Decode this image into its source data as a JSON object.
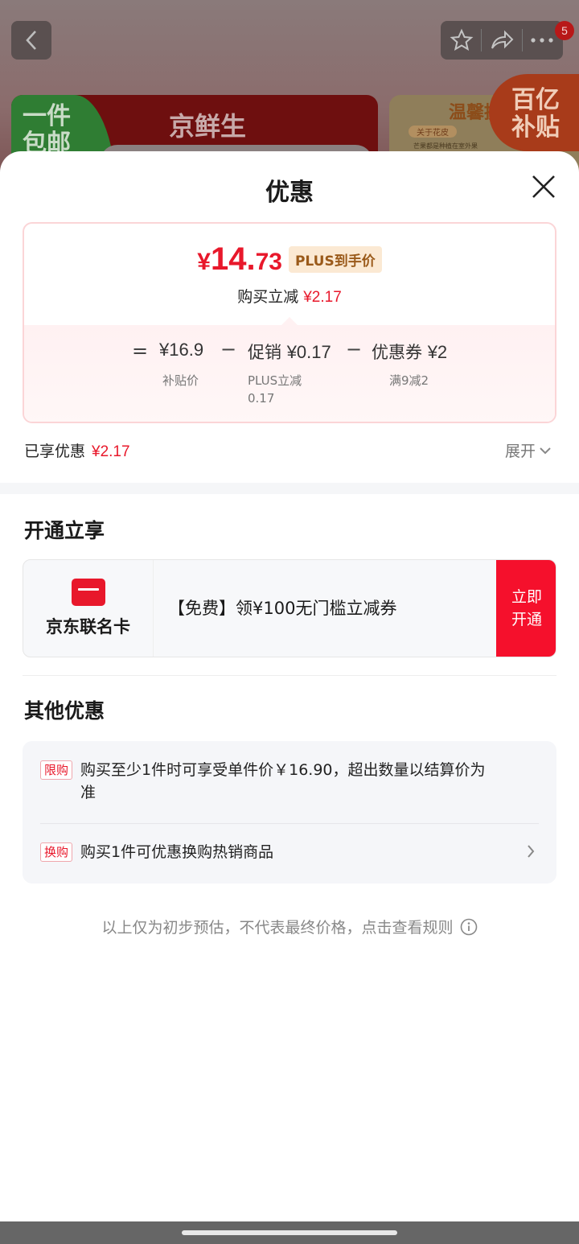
{
  "background": {
    "cart_badge": "5",
    "banner_left_tag": "一件包邮",
    "banner_left_title": "京鲜生",
    "banner_right_title": "温馨提",
    "banner_right_sub": "关于花皮",
    "banner_right_note": "芒果都是种植在室外果",
    "subsidy_label": "百亿补贴"
  },
  "sheet": {
    "title": "优惠"
  },
  "price_card": {
    "currency": "¥",
    "price_int": "14.",
    "price_dec": "73",
    "plus_tag": "PLUS到手价",
    "save_label": "购买立减",
    "save_amount": "¥2.17",
    "equals": "=",
    "minus": "−",
    "base_price": "¥16.9",
    "base_label": "补贴价",
    "promo_label": "促销",
    "promo_amount": "¥0.17",
    "promo_sub_line1": "PLUS立减",
    "promo_sub_line2": "0.17",
    "coupon_label": "优惠券",
    "coupon_amount": "¥2",
    "coupon_sub": "满9减2"
  },
  "enjoyed": {
    "label": "已享优惠",
    "amount": "¥2.17",
    "expand_label": "展开"
  },
  "open_section": {
    "title": "开通立享",
    "card_name": "京东联名卡",
    "offer_text": "【免费】领¥100无门槛立减券",
    "button_line1": "立即",
    "button_line2": "开通"
  },
  "other_section": {
    "title": "其他优惠",
    "items": [
      {
        "tag": "限购",
        "text": "购买至少1件时可享受单件价￥16.90，超出数量以结算价为准"
      },
      {
        "tag": "换购",
        "text": "购买1件可优惠换购热销商品"
      }
    ]
  },
  "footnote": "以上仅为初步预估，不代表最终价格，点击查看规则",
  "colors": {
    "accent_red": "#e8182b",
    "button_red": "#f5102c",
    "plus_gold": "#9a5a1a"
  }
}
